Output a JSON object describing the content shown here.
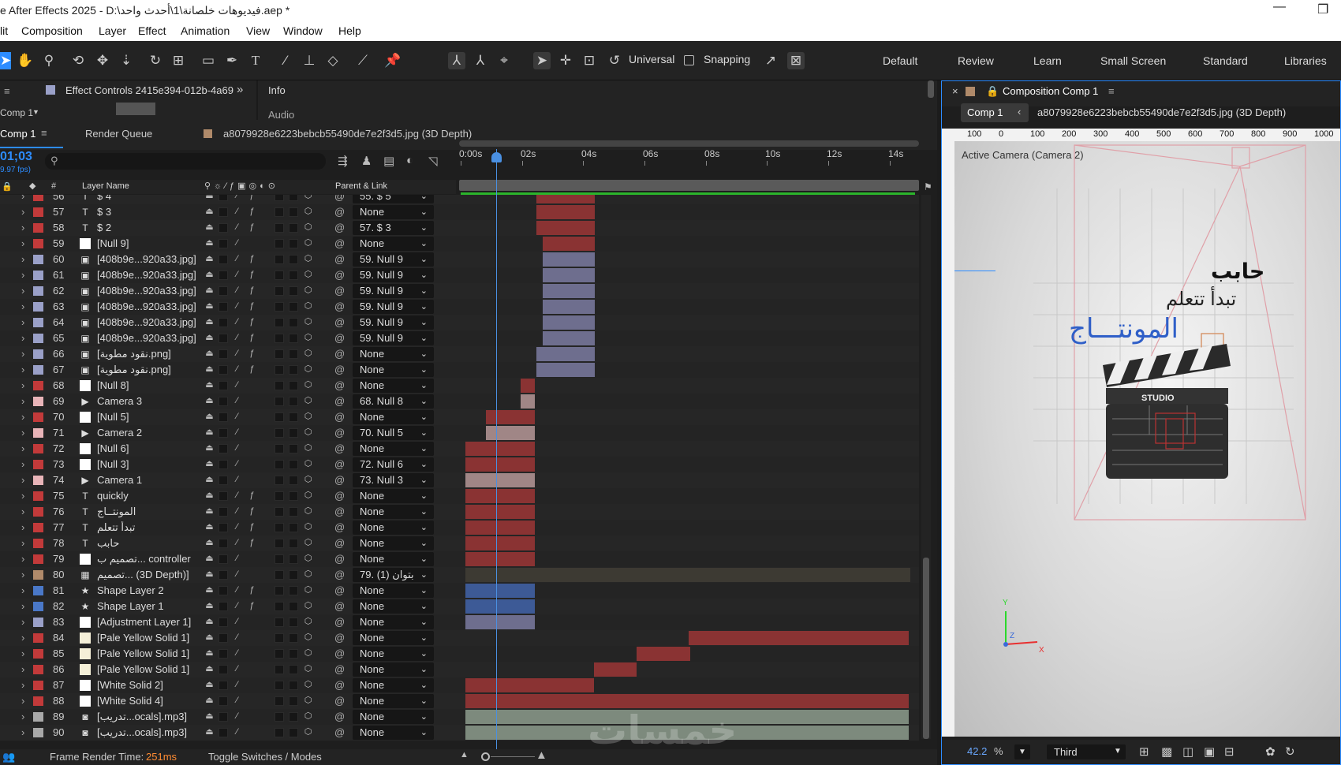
{
  "window": {
    "title": "e After Effects 2025 - D:\\فيديوهات خلصانة\\1\\أحدث واحد.aep *",
    "minimize": "—",
    "restore": "❐"
  },
  "menu": [
    "lit",
    "Composition",
    "Layer",
    "Effect",
    "Animation",
    "View",
    "Window",
    "Help"
  ],
  "toolbar": {
    "universal_label": "Universal",
    "snapping_label": "Snapping"
  },
  "workspaces": [
    "Default",
    "Review",
    "Learn",
    "Small Screen",
    "Standard",
    "Libraries"
  ],
  "effect_panel": {
    "tab": "Effect Controls 2415e394-012b-4a69",
    "comp_select": "Comp 1",
    "more": "»"
  },
  "info_panel": {
    "tab": "Info",
    "audio": "Audio"
  },
  "timeline_tabs": {
    "comp": "Comp 1",
    "render_queue": "Render Queue",
    "footage": "a8079928e6223bebcb55490de7e2f3d5.jpg (3D Depth)"
  },
  "timecode": {
    "value": "01;03",
    "fps": "9.97 fps)"
  },
  "columns": {
    "num": "#",
    "layer_name": "Layer Name",
    "parent_link": "Parent & Link"
  },
  "ruler": [
    "0:00s",
    "02s",
    "04s",
    "06s",
    "08s",
    "10s",
    "12s",
    "14s"
  ],
  "layers": [
    {
      "num": "56",
      "name": "$ 4",
      "type": "T",
      "color": "#c23a3a",
      "parent": "55. $ 5",
      "bar_start": 2.4,
      "bar_end": 4.25,
      "bar_color": "#8a3333"
    },
    {
      "num": "57",
      "name": "$ 3",
      "type": "T",
      "color": "#c23a3a",
      "parent": "None",
      "bar_start": 2.4,
      "bar_end": 4.25,
      "bar_color": "#8a3333"
    },
    {
      "num": "58",
      "name": "$ 2",
      "type": "T",
      "color": "#c23a3a",
      "parent": "57. $ 3",
      "bar_start": 2.4,
      "bar_end": 4.25,
      "bar_color": "#8a3333"
    },
    {
      "num": "59",
      "name": "[Null 9]",
      "type": "null",
      "color": "#c23a3a",
      "parent": "None",
      "bar_start": 2.6,
      "bar_end": 4.25,
      "bar_color": "#8a3333"
    },
    {
      "num": "60",
      "name": "[408b9e...920a33.jpg]",
      "type": "img",
      "color": "#9aa0c8",
      "parent": "59. Null 9",
      "bar_start": 2.6,
      "bar_end": 4.25,
      "bar_color": "#6e6e8e"
    },
    {
      "num": "61",
      "name": "[408b9e...920a33.jpg]",
      "type": "img",
      "color": "#9aa0c8",
      "parent": "59. Null 9",
      "bar_start": 2.6,
      "bar_end": 4.25,
      "bar_color": "#6e6e8e"
    },
    {
      "num": "62",
      "name": "[408b9e...920a33.jpg]",
      "type": "img",
      "color": "#9aa0c8",
      "parent": "59. Null 9",
      "bar_start": 2.6,
      "bar_end": 4.25,
      "bar_color": "#6e6e8e"
    },
    {
      "num": "63",
      "name": "[408b9e...920a33.jpg]",
      "type": "img",
      "color": "#9aa0c8",
      "parent": "59. Null 9",
      "bar_start": 2.6,
      "bar_end": 4.25,
      "bar_color": "#6e6e8e"
    },
    {
      "num": "64",
      "name": "[408b9e...920a33.jpg]",
      "type": "img",
      "color": "#9aa0c8",
      "parent": "59. Null 9",
      "bar_start": 2.6,
      "bar_end": 4.25,
      "bar_color": "#6e6e8e"
    },
    {
      "num": "65",
      "name": "[408b9e...920a33.jpg]",
      "type": "img",
      "color": "#9aa0c8",
      "parent": "59. Null 9",
      "bar_start": 2.6,
      "bar_end": 4.25,
      "bar_color": "#6e6e8e"
    },
    {
      "num": "66",
      "name": "[نقود مطوية.png]",
      "type": "img",
      "color": "#9aa0c8",
      "parent": "None",
      "bar_start": 2.4,
      "bar_end": 4.25,
      "bar_color": "#6e6e8e"
    },
    {
      "num": "67",
      "name": "[نقود مطوية.png]",
      "type": "img",
      "color": "#9aa0c8",
      "parent": "None",
      "bar_start": 2.4,
      "bar_end": 4.25,
      "bar_color": "#6e6e8e"
    },
    {
      "num": "68",
      "name": "[Null 8]",
      "type": "null",
      "color": "#c23a3a",
      "parent": "None",
      "bar_start": 1.9,
      "bar_end": 2.35,
      "bar_color": "#8a3333"
    },
    {
      "num": "69",
      "name": "Camera 3",
      "type": "cam",
      "color": "#e8b4b8",
      "parent": "68. Null 8",
      "bar_start": 1.9,
      "bar_end": 2.35,
      "bar_color": "#a08686"
    },
    {
      "num": "70",
      "name": "[Null 5]",
      "type": "null",
      "color": "#c23a3a",
      "parent": "None",
      "bar_start": 0.8,
      "bar_end": 2.35,
      "bar_color": "#8a3333"
    },
    {
      "num": "71",
      "name": "Camera 2",
      "type": "cam",
      "color": "#e8b4b8",
      "parent": "70. Null 5",
      "bar_start": 0.8,
      "bar_end": 2.35,
      "bar_color": "#a08686"
    },
    {
      "num": "72",
      "name": "[Null 6]",
      "type": "null",
      "color": "#c23a3a",
      "parent": "None",
      "bar_start": 0.15,
      "bar_end": 2.35,
      "bar_color": "#8a3333"
    },
    {
      "num": "73",
      "name": "[Null 3]",
      "type": "null",
      "color": "#c23a3a",
      "parent": "72. Null 6",
      "bar_start": 0.15,
      "bar_end": 2.35,
      "bar_color": "#8a3333"
    },
    {
      "num": "74",
      "name": "Camera 1",
      "type": "cam",
      "color": "#e8b4b8",
      "parent": "73. Null 3",
      "bar_start": 0.15,
      "bar_end": 2.35,
      "bar_color": "#a08686"
    },
    {
      "num": "75",
      "name": "quickly",
      "type": "T",
      "color": "#c23a3a",
      "parent": "None",
      "bar_start": 0.15,
      "bar_end": 2.35,
      "bar_color": "#8a3333"
    },
    {
      "num": "76",
      "name": "المونتــاج",
      "type": "T",
      "color": "#c23a3a",
      "parent": "None",
      "bar_start": 0.15,
      "bar_end": 2.35,
      "bar_color": "#8a3333"
    },
    {
      "num": "77",
      "name": "تبدأ تتعلم",
      "type": "T",
      "color": "#c23a3a",
      "parent": "None",
      "bar_start": 0.15,
      "bar_end": 2.35,
      "bar_color": "#8a3333"
    },
    {
      "num": "78",
      "name": "حابب",
      "type": "T",
      "color": "#c23a3a",
      "parent": "None",
      "bar_start": 0.15,
      "bar_end": 2.35,
      "bar_color": "#8a3333"
    },
    {
      "num": "79",
      "name": "تصميم ب... controller",
      "type": "null",
      "color": "#c23a3a",
      "parent": "None",
      "bar_start": 0.15,
      "bar_end": 2.35,
      "bar_color": "#8a3333"
    },
    {
      "num": "80",
      "name": "تصميم... (3D Depth)]",
      "type": "comp",
      "color": "#b08a6a",
      "parent": "79. بتوان (1)",
      "bar_start": 0.15,
      "bar_end": 14.3,
      "bar_color": "#3d3a33"
    },
    {
      "num": "81",
      "name": "Shape Layer 2",
      "type": "shape",
      "color": "#4a78c8",
      "parent": "None",
      "bar_start": 0.15,
      "bar_end": 2.35,
      "bar_color": "#3d5a96"
    },
    {
      "num": "82",
      "name": "Shape Layer 1",
      "type": "shape",
      "color": "#4a78c8",
      "parent": "None",
      "bar_start": 0.15,
      "bar_end": 2.35,
      "bar_color": "#3d5a96"
    },
    {
      "num": "83",
      "name": "[Adjustment Layer 1]",
      "type": "null",
      "color": "#9aa0c8",
      "parent": "None",
      "bar_start": 0.15,
      "bar_end": 2.35,
      "bar_color": "#6e6e8e"
    },
    {
      "num": "84",
      "name": "[Pale Yellow Solid 1]",
      "type": "solid",
      "color": "#c23a3a",
      "parent": "None",
      "bar_start": 7.25,
      "bar_end": 14.25,
      "bar_color": "#8a3333"
    },
    {
      "num": "85",
      "name": "[Pale Yellow Solid 1]",
      "type": "solid",
      "color": "#c23a3a",
      "parent": "None",
      "bar_start": 5.6,
      "bar_end": 7.3,
      "bar_color": "#8a3333"
    },
    {
      "num": "86",
      "name": "[Pale Yellow Solid 1]",
      "type": "solid",
      "color": "#c23a3a",
      "parent": "None",
      "bar_start": 4.25,
      "bar_end": 5.6,
      "bar_color": "#8a3333"
    },
    {
      "num": "87",
      "name": "[White Solid 2]",
      "type": "null",
      "color": "#c23a3a",
      "parent": "None",
      "bar_start": 0.15,
      "bar_end": 4.25,
      "bar_color": "#8a3333"
    },
    {
      "num": "88",
      "name": "[White Solid 4]",
      "type": "null",
      "color": "#c23a3a",
      "parent": "None",
      "bar_start": 0.15,
      "bar_end": 14.25,
      "bar_color": "#8a3333"
    },
    {
      "num": "89",
      "name": "[تدريب...ocals].mp3]",
      "type": "audio",
      "color": "#a8a8a8",
      "parent": "None",
      "bar_start": 0.15,
      "bar_end": 14.25,
      "bar_color": "#7d8a7d"
    },
    {
      "num": "90",
      "name": "[تدريب...ocals].mp3]",
      "type": "audio",
      "color": "#a8a8a8",
      "parent": "None",
      "bar_start": 0.15,
      "bar_end": 14.25,
      "bar_color": "#7d8a7d"
    }
  ],
  "status": {
    "render_label": "Frame Render Time:",
    "render_value": "251ms",
    "toggle": "Toggle Switches / Modes"
  },
  "watermark": "خمسات",
  "comp_panel": {
    "close": "×",
    "title": "Composition Comp 1",
    "breadcrumb": "Comp 1",
    "footage": "a8079928e6223bebcb55490de7e2f3d5.jpg (3D Depth)",
    "ruler": [
      "100",
      "0",
      "100",
      "200",
      "300",
      "400",
      "500",
      "600",
      "700",
      "800",
      "900",
      "1000"
    ],
    "camera_label": "Active Camera (Camera 2)",
    "text_line1": "حابب",
    "text_line2": "تبدأ تتعلم",
    "text_line3": "المونتـــاج",
    "slate_text": "STUDIO",
    "zoom": "42.2",
    "zoom_unit": "%",
    "resolution": "Third",
    "axis_y": "Y",
    "axis_x": "X",
    "axis_z": "Z",
    "accent": "#2d8cff"
  }
}
